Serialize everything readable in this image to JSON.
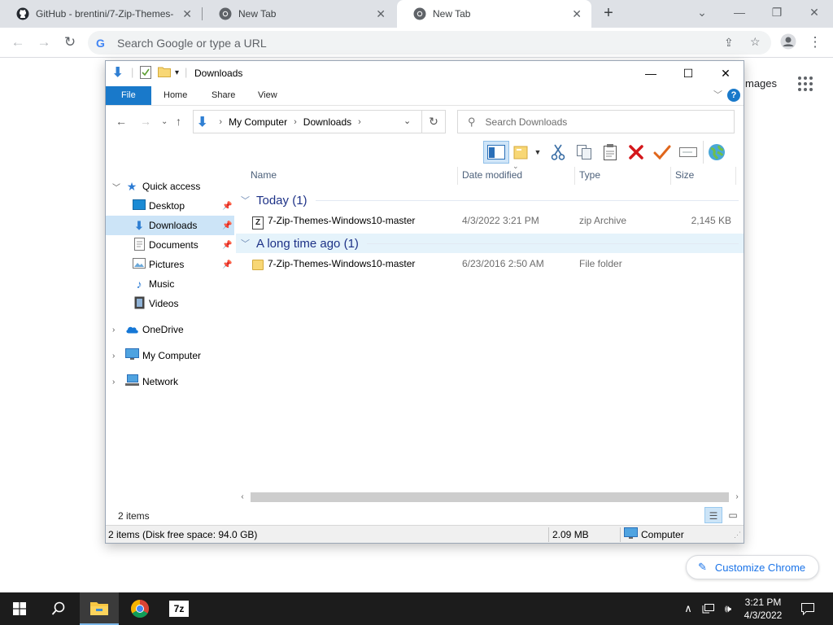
{
  "browser": {
    "tabs": [
      {
        "title": "GitHub - brentini/7-Zip-Themes-",
        "icon": "github-icon",
        "active": false
      },
      {
        "title": "New Tab",
        "icon": "chrome-icon",
        "active": false
      },
      {
        "title": "New Tab",
        "icon": "chrome-icon",
        "active": true
      }
    ],
    "omnibox_placeholder": "Search Google or type a URL",
    "ntp_images_text": "mages",
    "customize_label": "Customize Chrome"
  },
  "explorer": {
    "title": "Downloads",
    "ribbon_tabs": [
      "File",
      "Home",
      "Share",
      "View"
    ],
    "breadcrumb": [
      "My Computer",
      "Downloads"
    ],
    "search_placeholder": "Search Downloads",
    "nav": {
      "quick_access": "Quick access",
      "desktop": "Desktop",
      "downloads": "Downloads",
      "documents": "Documents",
      "pictures": "Pictures",
      "music": "Music",
      "videos": "Videos",
      "onedrive": "OneDrive",
      "my_computer": "My Computer",
      "network": "Network"
    },
    "columns": {
      "name": "Name",
      "date": "Date modified",
      "type": "Type",
      "size": "Size"
    },
    "groups": [
      {
        "label": "Today (1)",
        "files": [
          {
            "name": "7-Zip-Themes-Windows10-master",
            "date": "4/3/2022 3:21 PM",
            "type": "zip Archive",
            "size": "2,145 KB",
            "icon": "zip-archive-icon"
          }
        ]
      },
      {
        "label": "A long time ago (1)",
        "files": [
          {
            "name": "7-Zip-Themes-Windows10-master",
            "date": "6/23/2016 2:50 AM",
            "type": "File folder",
            "size": "",
            "icon": "folder-icon"
          }
        ]
      }
    ],
    "status_items": "2 items",
    "bottom_status": {
      "left": "2 items (Disk free space: 94.0 GB)",
      "size": "2.09 MB",
      "location": "Computer"
    }
  },
  "taskbar": {
    "time": "3:21 PM",
    "date": "4/3/2022",
    "apps": [
      "file-explorer",
      "chrome",
      "7-zip"
    ],
    "seven_zip_label": "7z"
  },
  "colors": {
    "accent": "#1979ca",
    "selection": "#cce4f7",
    "group_header": "#1e3287",
    "taskbar": "#1c1c1c"
  }
}
